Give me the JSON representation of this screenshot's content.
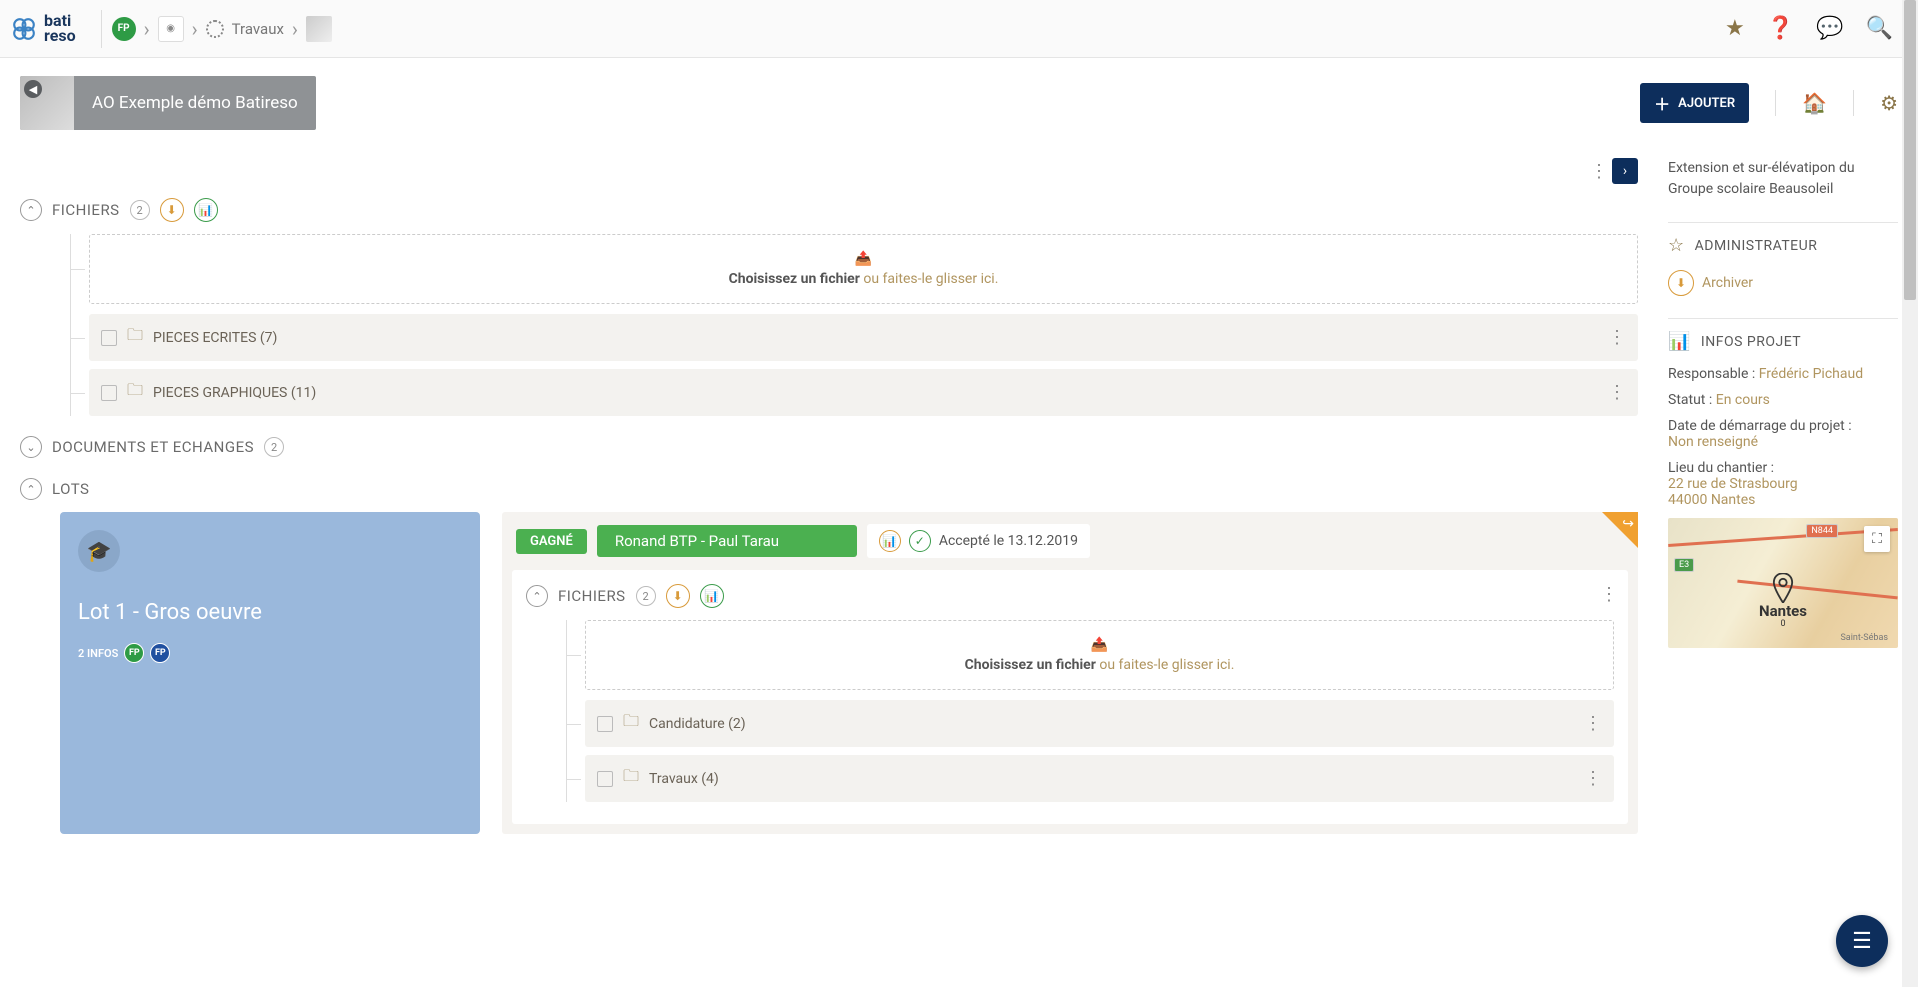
{
  "breadcrumb": {
    "avatar": "FP",
    "travaux": "Travaux"
  },
  "topbar": {
    "logo_top": "bati",
    "logo_bottom": "reso"
  },
  "header": {
    "title": "AO Exemple démo Batireso",
    "ajouter": "AJOUTER"
  },
  "sections": {
    "fichiers": {
      "title": "FICHIERS",
      "count": "2"
    },
    "documents": {
      "title": "DOCUMENTS ET ECHANGES",
      "count": "2"
    },
    "lots": {
      "title": "LOTS"
    }
  },
  "dropzone": {
    "main": "Choisissez un fichier ",
    "sub": "ou faites-le glisser ici."
  },
  "folders": {
    "pieces_ecrites": "PIECES ECRITES (7)",
    "pieces_graphiques": "PIECES GRAPHIQUES (11)",
    "candidature": "Candidature (2)",
    "travaux": "Travaux (4)"
  },
  "lot": {
    "title": "Lot 1 - Gros oeuvre",
    "infos": "2 INFOS",
    "avatar": "FP",
    "gagne": "GAGNÉ",
    "company": "Ronand BTP - Paul Tarau",
    "accepted": "Accepté le 13.12.2019",
    "fichiers_title": "FICHIERS",
    "fichiers_count": "2"
  },
  "sidebar": {
    "projet_desc": "Extension et sur-élévatipon du Groupe scolaire Beausoleil",
    "admin_title": "ADMINISTRATEUR",
    "archiver": "Archiver",
    "infos_title": "INFOS PROJET",
    "responsable_label": "Responsable : ",
    "responsable_val": "Frédéric Pichaud",
    "statut_label": "Statut : ",
    "statut_val": "En cours",
    "date_label": "Date de démarrage du projet :",
    "date_val": "Non renseigné",
    "lieu_label": "Lieu du chantier :",
    "lieu_line1": "22 rue de Strasbourg",
    "lieu_line2": "44000 Nantes",
    "map": {
      "city": "Nantes",
      "road1": "N844",
      "road2": "E3",
      "zoom": "0",
      "town1": "Sain",
      "town2": "Saint-Sébas"
    }
  }
}
